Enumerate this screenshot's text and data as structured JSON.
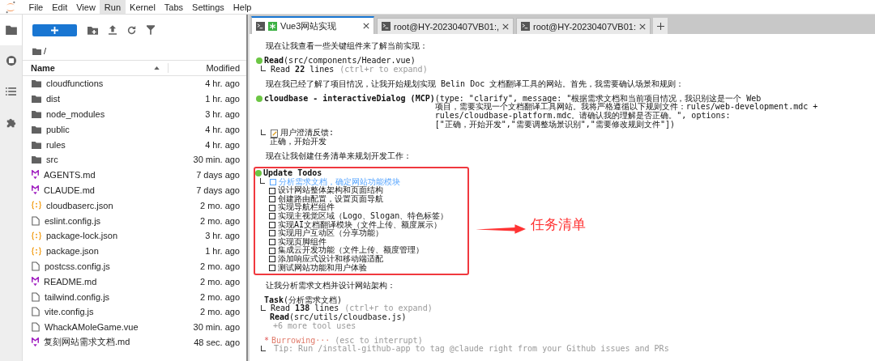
{
  "menu": [
    {
      "label": "File",
      "selected": false
    },
    {
      "label": "Edit",
      "selected": false
    },
    {
      "label": "View",
      "selected": false
    },
    {
      "label": "Run",
      "selected": true
    },
    {
      "label": "Kernel",
      "selected": false
    },
    {
      "label": "Tabs",
      "selected": false
    },
    {
      "label": "Settings",
      "selected": false
    },
    {
      "label": "Help",
      "selected": false
    }
  ],
  "file_browser": {
    "path": "/",
    "name_header": "Name",
    "modified_header": "Modified",
    "files": [
      {
        "name": "cloudfunctions",
        "modified": "4 hr. ago",
        "kind": "folder"
      },
      {
        "name": "dist",
        "modified": "1 hr. ago",
        "kind": "folder"
      },
      {
        "name": "node_modules",
        "modified": "3 hr. ago",
        "kind": "folder"
      },
      {
        "name": "public",
        "modified": "4 hr. ago",
        "kind": "folder"
      },
      {
        "name": "rules",
        "modified": "4 hr. ago",
        "kind": "folder"
      },
      {
        "name": "src",
        "modified": "30 min. ago",
        "kind": "folder"
      },
      {
        "name": "AGENTS.md",
        "modified": "7 days ago",
        "kind": "markdown"
      },
      {
        "name": "CLAUDE.md",
        "modified": "7 days ago",
        "kind": "markdown"
      },
      {
        "name": "cloudbaserc.json",
        "modified": "2 mo. ago",
        "kind": "json"
      },
      {
        "name": "eslint.config.js",
        "modified": "2 mo. ago",
        "kind": "file"
      },
      {
        "name": "package-lock.json",
        "modified": "3 hr. ago",
        "kind": "json"
      },
      {
        "name": "package.json",
        "modified": "1 hr. ago",
        "kind": "json"
      },
      {
        "name": "postcss.config.js",
        "modified": "2 mo. ago",
        "kind": "file"
      },
      {
        "name": "README.md",
        "modified": "2 mo. ago",
        "kind": "markdown"
      },
      {
        "name": "tailwind.config.js",
        "modified": "2 mo. ago",
        "kind": "file"
      },
      {
        "name": "vite.config.js",
        "modified": "2 mo. ago",
        "kind": "file"
      },
      {
        "name": "WhackAMoleGame.vue",
        "modified": "30 min. ago",
        "kind": "file"
      },
      {
        "name": "复刻网站需求文档.md",
        "modified": "48 sec. ago",
        "kind": "markdown"
      }
    ]
  },
  "tabs": [
    {
      "label": "Vue3网站实现",
      "selected": true,
      "kind": "agent"
    },
    {
      "label": "root@HY-20230407VB01:,",
      "selected": false,
      "kind": "terminal"
    },
    {
      "label": "root@HY-20230407VB01:",
      "selected": false,
      "kind": "terminal"
    }
  ],
  "terminal": [
    {
      "kind": "text",
      "text": "现在让我查看一些关键组件来了解当前实现："
    },
    {
      "kind": "tool",
      "color": "#6cc644",
      "name": "Read",
      "args": [
        "(src/components/Header.vue)"
      ],
      "results": [
        {
          "kind": "line",
          "text": "Read **22** lines",
          "hint": "(ctrl+r to expand)"
        }
      ]
    },
    {
      "kind": "text",
      "text": "现在我已经了解了项目情况，让我开始规划实现 Belin Doc 文档翻译工具的网站。首先，我需要确认场景和规则："
    },
    {
      "kind": "tool",
      "color": "#6cc644",
      "name": "cloudbase - interactiveDialog (MCP)",
      "args": [
        "(type: \"clarify\", message: \"根据需求文档和当前项目情况，我识别这是一个 Web",
        "项目，需要实现一个文档翻译工具网站。我将严格遵循以下规则文件：rules/web-development.mdc +",
        "rules/cloudbase-platform.mdc。请确认我的理解是否正确。\", options:",
        "[\"正确，开始开发\",\"需要调整场景识别\",\"需要修改规则文件\"])"
      ],
      "results": [
        {
          "kind": "note",
          "text": "用户澄清反馈:"
        },
        {
          "kind": "line",
          "text": "正确，开始开发"
        }
      ]
    },
    {
      "kind": "text",
      "text": "现在让我创建任务清单来规划开发工作："
    },
    {
      "kind": "todos",
      "color": "#6cc644",
      "title": "Update Todos",
      "callout": "任务清单",
      "items": [
        {
          "text": "分析需求文档，确定网站功能模块",
          "checked": false,
          "active": true
        },
        {
          "text": "设计网站整体架构和页面结构",
          "checked": false,
          "active": false
        },
        {
          "text": "创建路由配置，设置页面导航",
          "checked": false,
          "active": false
        },
        {
          "text": "实现导航栏组件",
          "checked": false,
          "active": false
        },
        {
          "text": "实现主视觉区域（Logo、Slogan、特色标签）",
          "checked": false,
          "active": false
        },
        {
          "text": "实现AI文档翻译模块（文件上传、额度展示）",
          "checked": false,
          "active": false
        },
        {
          "text": "实现用户互动区（分享功能）",
          "checked": false,
          "active": false
        },
        {
          "text": "实现页脚组件",
          "checked": false,
          "active": false
        },
        {
          "text": "集成云开发功能（文件上传、额度管理）",
          "checked": false,
          "active": false
        },
        {
          "text": "添加响应式设计和移动端适配",
          "checked": false,
          "active": false
        },
        {
          "text": "测试网站功能和用户体验",
          "checked": false,
          "active": false
        }
      ]
    },
    {
      "kind": "text",
      "text": "让我分析需求文档并设计网站架构："
    },
    {
      "kind": "tool",
      "name": "Task",
      "args": [
        "(分析需求文档)"
      ],
      "results": [
        {
          "kind": "line",
          "text": "Read **138** lines",
          "hint": "(ctrl+r to expand)"
        },
        {
          "kind": "line",
          "text": "**Read**(src/utils/cloudbase.js)"
        },
        {
          "kind": "dim",
          "text": "+6 more tool uses"
        }
      ]
    },
    {
      "kind": "status",
      "mark": "*",
      "name": "Burrowing···",
      "hint": "(esc to interrupt)",
      "results": [
        {
          "kind": "dim",
          "text": "Tip: Run /install-github-app to tag @claude right from your Github issues and PRs"
        }
      ]
    }
  ]
}
